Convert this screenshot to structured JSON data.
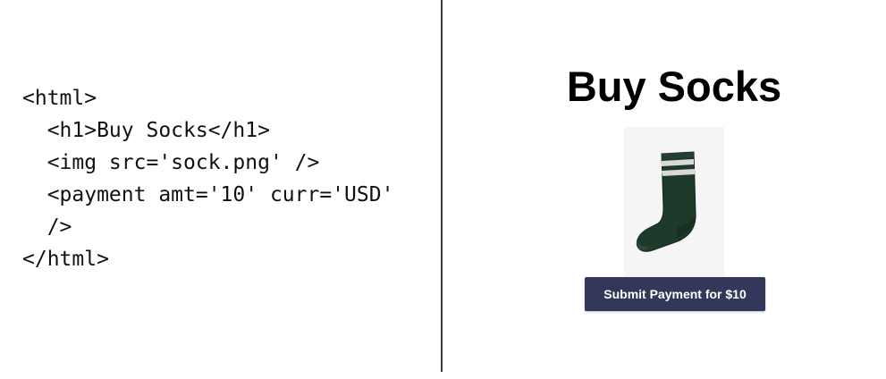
{
  "code": {
    "lines": [
      "<html>",
      "  <h1>Buy Socks</h1>",
      "  <img src='sock.png' />",
      "  <payment amt='10' curr='USD'",
      "  />",
      "</html>"
    ]
  },
  "preview": {
    "title": "Buy Socks",
    "image_icon": "sock-image",
    "button_label": "Submit Payment for $10"
  },
  "colors": {
    "button_bg": "#333759",
    "button_text": "#ffffff",
    "sock_green": "#1e3a2a",
    "sock_stripe": "#d9d9d9",
    "divider": "#3a3a3a"
  }
}
